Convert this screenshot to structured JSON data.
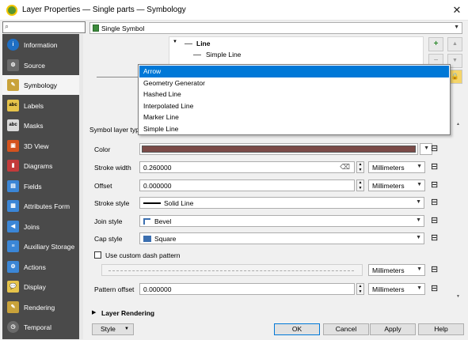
{
  "window": {
    "title": "Layer Properties — Single parts — Symbology",
    "close": "✕"
  },
  "sidebar": {
    "items": [
      {
        "label": "Information",
        "icon": "i",
        "color": "#1f6fc4"
      },
      {
        "label": "Source",
        "icon": "⚙",
        "color": "#6a6a6a"
      },
      {
        "label": "Symbology",
        "icon": "✎",
        "color": "#c9a23a"
      },
      {
        "label": "Labels",
        "icon": "abc",
        "color": "#e6c34a"
      },
      {
        "label": "Masks",
        "icon": "abc",
        "color": "#d9d9d9"
      },
      {
        "label": "3D View",
        "icon": "▣",
        "color": "#d4531e"
      },
      {
        "label": "Diagrams",
        "icon": "▮",
        "color": "#c33b3b"
      },
      {
        "label": "Fields",
        "icon": "▤",
        "color": "#3b86d6"
      },
      {
        "label": "Attributes Form",
        "icon": "▦",
        "color": "#3b86d6"
      },
      {
        "label": "Joins",
        "icon": "◀",
        "color": "#3b86d6"
      },
      {
        "label": "Auxiliary Storage",
        "icon": "≡",
        "color": "#3b86d6"
      },
      {
        "label": "Actions",
        "icon": "⚙",
        "color": "#3b86d6"
      },
      {
        "label": "Display",
        "icon": "💬",
        "color": "#e6c34a"
      },
      {
        "label": "Rendering",
        "icon": "✎",
        "color": "#c9a23a"
      },
      {
        "label": "Temporal",
        "icon": "◷",
        "color": "#6a6a6a"
      }
    ]
  },
  "renderer": {
    "value": "Single Symbol"
  },
  "tree": {
    "root": "Line",
    "child": "Simple Line"
  },
  "symbol_layer_type_label": "Symbol layer type",
  "dropdown": {
    "items": [
      "Arrow",
      "Geometry Generator",
      "Hashed Line",
      "Interpolated Line",
      "Marker Line",
      "Simple Line"
    ],
    "highlighted": "Arrow"
  },
  "form": {
    "color_label": "Color",
    "color_value": "#7a4a47",
    "stroke_width_label": "Stroke width",
    "stroke_width_value": "0.260000",
    "offset_label": "Offset",
    "offset_value": "0.000000",
    "stroke_style_label": "Stroke style",
    "stroke_style_value": "Solid Line",
    "join_style_label": "Join style",
    "join_style_value": "Bevel",
    "cap_style_label": "Cap style",
    "cap_style_value": "Square",
    "custom_dash_label": "Use custom dash pattern",
    "pattern_offset_label": "Pattern offset",
    "pattern_offset_value": "0.000000",
    "unit": "Millimeters"
  },
  "layer_rendering_label": "Layer Rendering",
  "buttons": {
    "style": "Style",
    "ok": "OK",
    "cancel": "Cancel",
    "apply": "Apply",
    "help": "Help"
  }
}
